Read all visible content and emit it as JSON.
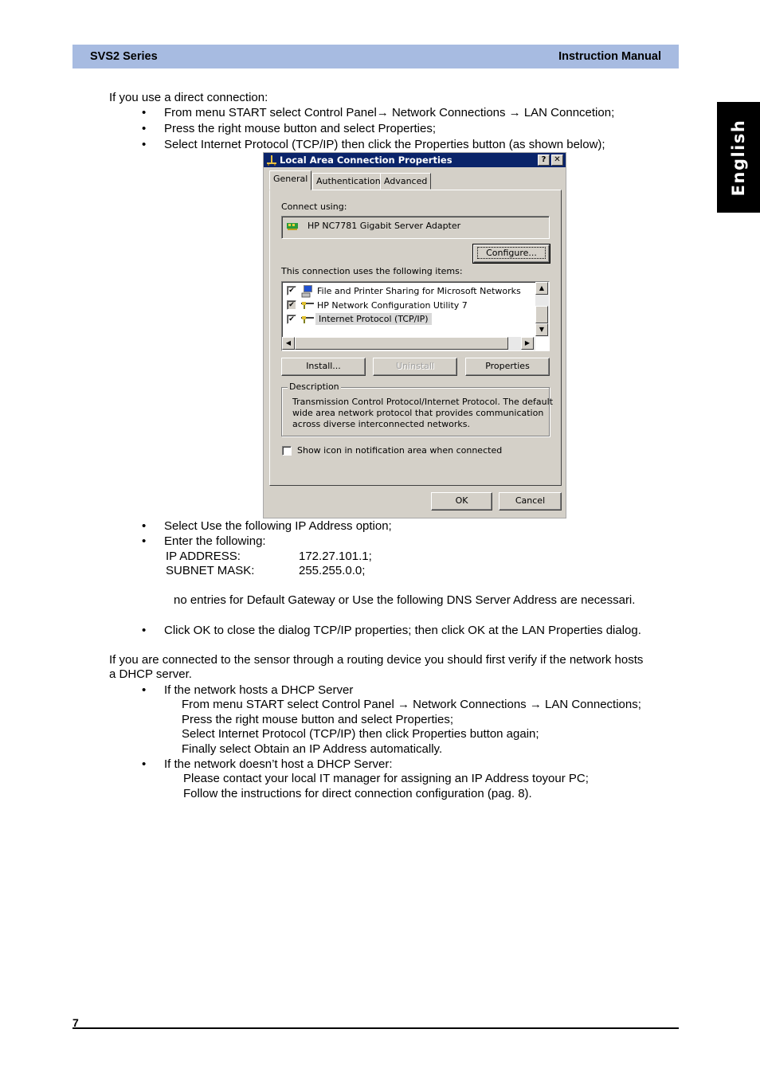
{
  "header": {
    "left": "SVS2 Series",
    "right": "Instruction Manual"
  },
  "language_tab": "English",
  "section1": {
    "intro": "If you use a direct connection:",
    "bullets": [
      "From menu START select Control Panel→ Network Connections → LAN Conncetion;",
      "Press the right mouse button and select Properties;",
      "Select Internet Protocol (TCP/IP) then click the Properties button (as shown below);"
    ]
  },
  "dialog": {
    "title": "Local Area Connection Properties",
    "help_button": "?",
    "close_button": "✕",
    "tabs": [
      "General",
      "Authentication",
      "Advanced"
    ],
    "active_tab": "General",
    "connect_using_label": "Connect using:",
    "adapter_name": "HP NC7781 Gigabit Server Adapter",
    "configure_button": "Configure...",
    "items_label": "This connection uses the following items:",
    "items": [
      {
        "label": "File and Printer Sharing for Microsoft Networks",
        "checked": true,
        "icon": "computer-printer-icon",
        "selected": false
      },
      {
        "label": "HP Network Configuration Utility 7",
        "checked": true,
        "icon": "network-protocol-icon",
        "selected": false
      },
      {
        "label": "Internet Protocol (TCP/IP)",
        "checked": true,
        "icon": "network-protocol-icon",
        "selected": true
      }
    ],
    "install_button": "Install...",
    "uninstall_button": "Uninstall",
    "properties_button": "Properties",
    "description_label": "Description",
    "description_text": [
      "Transmission Control Protocol/Internet Protocol. The default",
      "wide area network protocol that provides communication",
      "across diverse interconnected networks."
    ],
    "show_icon_label": "Show icon in notification area when connected",
    "show_icon_checked": false,
    "ok_button": "OK",
    "cancel_button": "Cancel"
  },
  "section2": {
    "bullets": [
      "Select Use the following IP Address option;",
      "Enter the following:"
    ],
    "ip_label": "IP ADDRESS:",
    "ip_value": "172.27.101.1;",
    "mask_label": "SUBNET MASK:",
    "mask_value": "255.255.0.0;",
    "note": "no entries for Default Gateway or Use the following DNS Server Address are necessari.",
    "close_bullet": "Click OK to close the dialog TCP/IP properties; then click OK at the LAN Properties dialog."
  },
  "section3": {
    "intro_line1": "If you are connected to the sensor through a routing device you should first verify if the network hosts",
    "intro_line2": "a DHCP server.",
    "dhcp_yes": {
      "title": "If the network hosts a DHCP Server",
      "steps": [
        "From menu START select Control Panel → Network Connections → LAN Connections;",
        "Press the right mouse button and select Properties;",
        "Select Internet Protocol (TCP/IP) then click Properties button again;",
        "Finally select Obtain an IP Address automatically."
      ]
    },
    "dhcp_no": {
      "title": "If the network doesn’t host a DHCP Server:",
      "steps": [
        "Please contact your local IT manager for assigning an IP Address toyour PC;",
        "Follow the instructions for direct connection configuration (pag. 8)."
      ]
    }
  },
  "footer": {
    "page_number": "7"
  }
}
